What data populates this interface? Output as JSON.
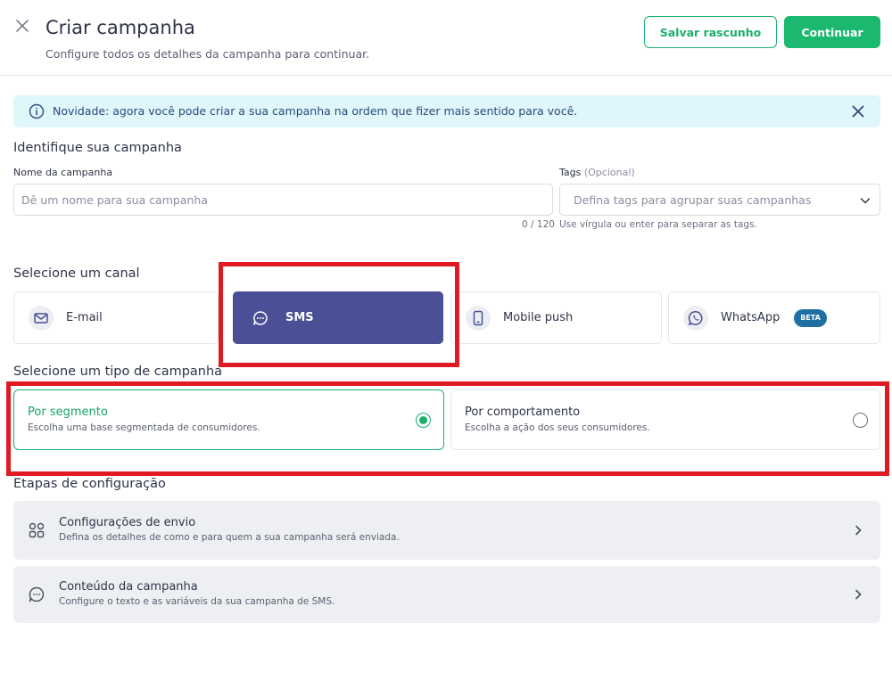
{
  "header": {
    "title": "Criar campanha",
    "subtitle": "Configure todos os detalhes da campanha para continuar.",
    "save_draft_label": "Salvar rascunho",
    "continue_label": "Continuar"
  },
  "banner": {
    "text": "Novidade: agora você pode criar a sua campanha na ordem que fizer mais sentido para você."
  },
  "identify": {
    "section_title": "Identifique sua campanha",
    "name_label": "Nome da campanha",
    "name_placeholder": "Dê um nome para sua campanha",
    "name_value": "",
    "char_counter": "0 / 120",
    "tags_label": "Tags",
    "tags_optional": "(Opcional)",
    "tags_placeholder": "Defina tags para agrupar suas campanhas",
    "tags_helper": "Use vírgula ou enter para separar as tags."
  },
  "channel": {
    "section_title": "Selecione um canal",
    "options": [
      {
        "label": "E-mail",
        "icon": "mail-icon",
        "selected": false
      },
      {
        "label": "SMS",
        "icon": "chat-bubble-icon",
        "selected": true
      },
      {
        "label": "Mobile push",
        "icon": "smartphone-icon",
        "selected": false
      },
      {
        "label": "WhatsApp",
        "icon": "whatsapp-icon",
        "selected": false,
        "badge": "BETA"
      }
    ]
  },
  "campaign_type": {
    "section_title": "Selecione um tipo de campanha",
    "options": [
      {
        "title": "Por segmento",
        "description": "Escolha uma base segmentada de consumidores.",
        "selected": true
      },
      {
        "title": "Por comportamento",
        "description": "Escolha a ação dos seus consumidores.",
        "selected": false
      }
    ]
  },
  "steps": {
    "section_title": "Etapas de configuração",
    "items": [
      {
        "title": "Configurações de envio",
        "description": "Defina os detalhes de como e para quem a sua campanha será enviada.",
        "icon": "grid-icon"
      },
      {
        "title": "Conteúdo da campanha",
        "description": "Configure o texto e as variáveis da sua campanha de SMS.",
        "icon": "chat-bubble-icon"
      }
    ]
  },
  "colors": {
    "primary_green": "#1bb86f",
    "channel_selected": "#4a4f96",
    "banner_bg": "#dff7fb",
    "highlight_red": "#e01a22",
    "beta_badge": "#1e6fa3"
  }
}
